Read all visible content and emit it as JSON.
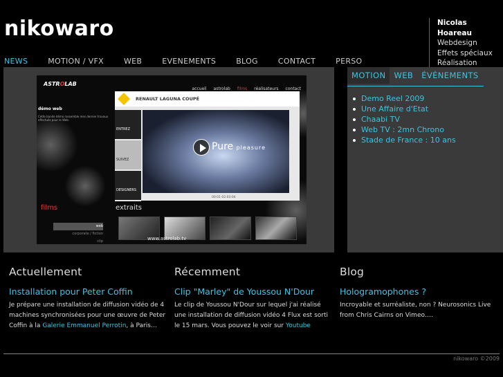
{
  "site": {
    "logo": "nikowaro",
    "copyright": "nikowaro ©2009"
  },
  "profile": {
    "name": "Nicolas Hoareau",
    "roles": [
      "Webdesign",
      "Effets spéciaux",
      "Réalisation"
    ]
  },
  "nav": {
    "items": [
      "NEWS",
      "MOTION / VFX",
      "WEB",
      "EVENEMENTS",
      "BLOG",
      "CONTACT",
      "PERSO"
    ],
    "active": "NEWS"
  },
  "showcase": {
    "brand_a": "ASTR",
    "brand_b": "LAB",
    "site_nav": [
      "accueil",
      "astrolab",
      "films",
      "réalisateurs",
      "contact"
    ],
    "demo_title": "démo web",
    "demo_text": "Cette bande démo rassemble mes dernier travaux effectués pour le Web.",
    "panel_title": "RENAULT LAGUNA COUPÉ",
    "side_buttons": [
      "ENTREZ",
      "SUIVEZ",
      "DESIGNERS"
    ],
    "video_text": "Pure",
    "video_subtext": "pleasure",
    "timecode": "00:01 02:03:04",
    "films_label": "films",
    "extraits_label": "extraits",
    "films_list": [
      "web",
      "corporate / fiction",
      "clip"
    ],
    "url": "www.astrolab.tv"
  },
  "projects": {
    "tabs": [
      "MOTION",
      "WEB",
      "ÉVÉNEMENTS"
    ],
    "active_tab": "MOTION",
    "items": [
      "Demo Reel 2009",
      "Une Affaire d'Etat",
      "Chaabi TV",
      "Web TV : 2mn Chrono",
      "Stade de France : 10 ans"
    ]
  },
  "columns": [
    {
      "heading": "Actuellement",
      "title": "Installation pour Peter Coffin",
      "text_before": "Je prépare une installation de diffusion vidéo de 4 machines synchronisées pour une œuvre de Peter Coffin à la ",
      "link": "Galerie Emmanuel Perrotin",
      "text_after": ", à Paris…"
    },
    {
      "heading": "Récemment",
      "title": "Clip \"Marley\" de Youssou N'Dour",
      "text_before": "Le clip de Youssou N'Dour sur lequel j'ai réalisé une installation de diffusion vidéo 4 Flux est sorti le 15 mars. Vous pouvez le voir sur ",
      "link": "Youtube",
      "text_after": ""
    },
    {
      "heading": "Blog",
      "title": "Hologramophones ?",
      "text_before": "Incroyable et surréaliste, non ? Neurosonics Live from Chris Cairns on Vimeo….",
      "link": "",
      "text_after": ""
    }
  ]
}
